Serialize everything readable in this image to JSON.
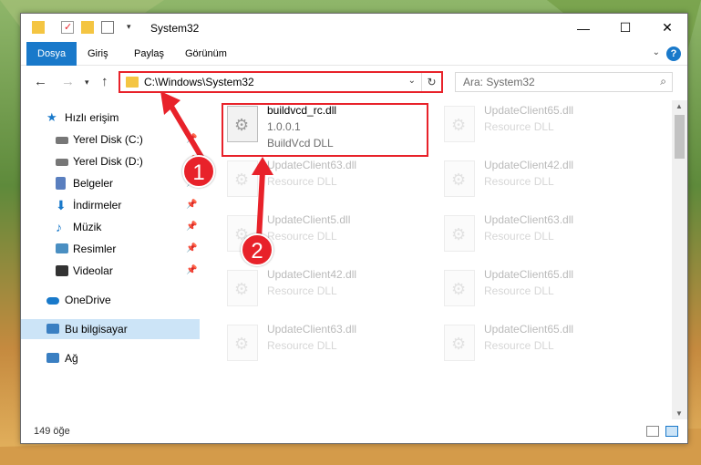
{
  "window": {
    "title": "System32",
    "controls": {
      "minimize": "—",
      "maximize": "☐",
      "close": "✕"
    }
  },
  "ribbon": {
    "tabs": [
      "Dosya",
      "Giriş",
      "Paylaş",
      "Görünüm"
    ],
    "help": "?"
  },
  "nav": {
    "address": "C:\\Windows\\System32",
    "search_placeholder": "Ara: System32"
  },
  "sidebar": {
    "items": [
      {
        "label": "Hızlı erişim",
        "icon": "star-icon",
        "color": "#1979ca"
      },
      {
        "label": "Yerel Disk (C:)",
        "icon": "drive-icon",
        "color": "#666666"
      },
      {
        "label": "Yerel Disk (D:)",
        "icon": "drive-icon",
        "color": "#666666"
      },
      {
        "label": "Belgeler",
        "icon": "documents-icon",
        "color": "#5a7fbf"
      },
      {
        "label": "İndirmeler",
        "icon": "download-icon",
        "color": "#1979ca"
      },
      {
        "label": "Müzik",
        "icon": "music-icon",
        "color": "#1979ca"
      },
      {
        "label": "Resimler",
        "icon": "pictures-icon",
        "color": "#4a8fc2"
      },
      {
        "label": "Videolar",
        "icon": "videos-icon",
        "color": "#333333"
      },
      {
        "label": "OneDrive",
        "icon": "cloud-icon",
        "color": "#1979ca"
      },
      {
        "label": "Bu bilgisayar",
        "icon": "computer-icon",
        "color": "#3a7fc2"
      },
      {
        "label": "Ağ",
        "icon": "network-icon",
        "color": "#3a7fc2"
      }
    ]
  },
  "files": {
    "selected": {
      "name": "buildvcd_rc.dll",
      "version": "1.0.0.1",
      "desc": "BuildVcd DLL"
    },
    "grid": [
      {
        "name": "UpdateClient65.dll",
        "desc": "Resource DLL"
      },
      {
        "name": "UpdateClient63.dll",
        "desc": "Resource DLL"
      },
      {
        "name": "UpdateClient42.dll",
        "desc": "Resource DLL"
      },
      {
        "name": "UpdateClient5.dll",
        "desc": "Resource DLL"
      },
      {
        "name": "UpdateClient63.dll",
        "desc": "Resource DLL"
      },
      {
        "name": "UpdateClient42.dll",
        "desc": "Resource DLL"
      },
      {
        "name": "UpdateClient65.dll",
        "desc": "Resource DLL"
      },
      {
        "name": "UpdateClient63.dll",
        "desc": "Resource DLL"
      },
      {
        "name": "UpdateClient65.dll",
        "desc": "Resource DLL"
      }
    ]
  },
  "status": {
    "count": "149 öğe"
  },
  "callouts": {
    "one": "1",
    "two": "2"
  },
  "colors": {
    "accent": "#1979ca",
    "highlight": "#e8222a"
  }
}
